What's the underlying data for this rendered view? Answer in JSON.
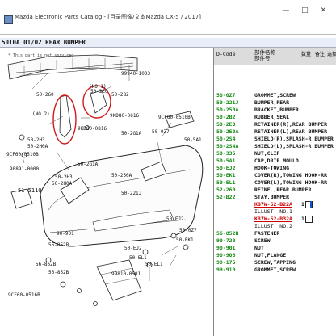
{
  "window": {
    "title": "Mazda Electronic Parts Catalog - [目录图像/文本Mazda CX-5 / 2017]",
    "controls": "— □ ✕"
  },
  "section_header": "5010A 01/02 REAR BUMPER",
  "diagram": {
    "note": "* This part is not serviced",
    "labels": [
      "50-260",
      "99940-1003",
      "(NO.1)",
      "50-2E0",
      "50-2B2",
      "9KD80-0616",
      "(NO.2)",
      "50-2H3",
      "50-2H0A",
      "9KD80-0816",
      "50-0Z7",
      "9CF60-0510B",
      "50-5A1",
      "50-2G1A",
      "9CF60-0510B",
      "90891-0000",
      "50-2G1A",
      "50-250A",
      "50-221J",
      "50-2H3",
      "50-2H0A",
      "51 5110",
      "50-EJ2",
      "50-0Z7",
      "50-EK1",
      "56-852B",
      "50-EJ2",
      "90-901",
      "50-EL1",
      "56-852B",
      "50-EL1",
      "56-852B",
      "99810-0501",
      "9CF60-0516B"
    ]
  },
  "parts_list": {
    "headers": {
      "code": "D-Code",
      "name_line1": "部件名称",
      "name_line2": "部件号",
      "col3": "数量",
      "col4": "备注",
      "col5": "选择"
    },
    "rows": [
      {
        "code": "50-0Z7",
        "name": "GROMMET,SCREW"
      },
      {
        "code": "50-221J",
        "name": "BUMPER,REAR"
      },
      {
        "code": "50-250A",
        "name": "BRACKET,BUMPER"
      },
      {
        "code": "50-2B2",
        "name": "RUBBER,SEAL"
      },
      {
        "code": "50-2E0",
        "name": "RETAINER(R),REAR BUMPER"
      },
      {
        "code": "50-2E0A",
        "name": "RETAINER(L),REAR BUMPER"
      },
      {
        "code": "50-2S4",
        "name": "SHIELD(R),SPLASH-R.BUMPER"
      },
      {
        "code": "50-2S4A",
        "name": "SHIELD(L),SPLASH-R.BUMPER"
      },
      {
        "code": "50-335",
        "name": "NUT,CLIP"
      },
      {
        "code": "50-5A1",
        "name": "CAP,DRIP MOULD"
      },
      {
        "code": "50-EJ2",
        "name": "HOOK-TOWING"
      },
      {
        "code": "50-EK1",
        "name": "COVER(R),TOWING HOOK-RR"
      },
      {
        "code": "50-EL1",
        "name": "COVER(L),TOWING HOOK-RR"
      },
      {
        "code": "52-260",
        "name": "REINF.,REAR BUMPER"
      },
      {
        "code": "52-B22",
        "name": "STAY,BUMPER"
      },
      {
        "code": "",
        "name": "KB7W-52-B22A",
        "qty": "1",
        "selected": true,
        "box": true,
        "cursor": true
      },
      {
        "code": "",
        "name": "ILLUST. NO.1",
        "ill": true
      },
      {
        "code": "",
        "name": "KB7W-52-B32A",
        "qty": "1",
        "selected": true,
        "box": true
      },
      {
        "code": "",
        "name": "ILLUST. NO.2",
        "ill": true
      },
      {
        "code": "56-852B",
        "name": "FASTENER"
      },
      {
        "code": "90-720",
        "name": "SCREW"
      },
      {
        "code": "90-901",
        "name": "NUT"
      },
      {
        "code": "90-906",
        "name": "NUT,FLANGE"
      },
      {
        "code": "99-175",
        "name": "SCREW,TAPPING"
      },
      {
        "code": "99-910",
        "name": "GROMMET,SCREW"
      }
    ]
  },
  "colors": {
    "code_green": "#128a12",
    "selected_red": "#c00000",
    "highlight_circle": "#d11a1a"
  }
}
